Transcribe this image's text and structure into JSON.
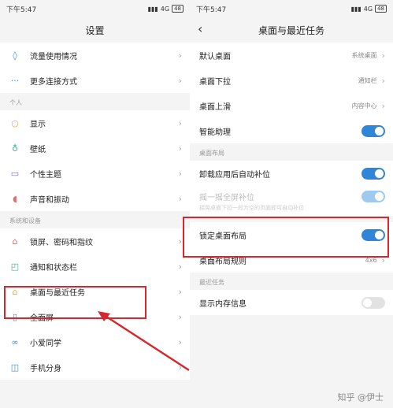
{
  "left": {
    "status": {
      "time": "下午5:47",
      "signal": "4G",
      "battery": "48"
    },
    "title": "设置",
    "top_items": [
      {
        "label": "流量使用情况",
        "icon": "data-usage-icon"
      },
      {
        "label": "更多连接方式",
        "icon": "more-connections-icon"
      }
    ],
    "section_personal": "个人",
    "personal_items": [
      {
        "label": "显示",
        "icon": "display-icon"
      },
      {
        "label": "壁纸",
        "icon": "wallpaper-icon"
      },
      {
        "label": "个性主题",
        "icon": "theme-icon"
      },
      {
        "label": "声音和振动",
        "icon": "sound-icon"
      }
    ],
    "section_system": "系统和设备",
    "system_items": [
      {
        "label": "锁屏、密码和指纹",
        "icon": "lock-icon"
      },
      {
        "label": "通知和状态栏",
        "icon": "notification-icon"
      },
      {
        "label": "桌面与最近任务",
        "icon": "home-icon"
      },
      {
        "label": "全面屏",
        "icon": "fullscreen-icon"
      },
      {
        "label": "小爱同学",
        "icon": "assistant-icon"
      },
      {
        "label": "手机分身",
        "icon": "second-space-icon"
      }
    ]
  },
  "right": {
    "status": {
      "time": "下午5:47",
      "signal": "4G",
      "battery": "48"
    },
    "title": "桌面与最近任务",
    "items_top": [
      {
        "label": "默认桌面",
        "value": "系统桌面"
      },
      {
        "label": "桌面下拉",
        "value": "通知栏"
      },
      {
        "label": "桌面上滑",
        "value": "内容中心"
      },
      {
        "label": "智能助理",
        "toggle": "on"
      }
    ],
    "section_layout": "桌面布局",
    "layout_items": [
      {
        "label": "卸载应用后自动补位",
        "toggle": "on"
      },
      {
        "label": "摇一摇全屏补位",
        "sub": "摇晃桌面下拉一段为空的页面即可自动补位",
        "toggle": "dim"
      },
      {
        "label": "锁定桌面布局",
        "toggle": "on"
      },
      {
        "label": "桌面布局规则",
        "value": "4x6"
      }
    ],
    "section_recent": "最近任务",
    "recent_items": [
      {
        "label": "显示内存信息",
        "toggle": "off"
      }
    ]
  },
  "watermark": "知乎 @伊士",
  "colors": {
    "accent": "#2f86d9",
    "highlight": "#d8262c"
  }
}
